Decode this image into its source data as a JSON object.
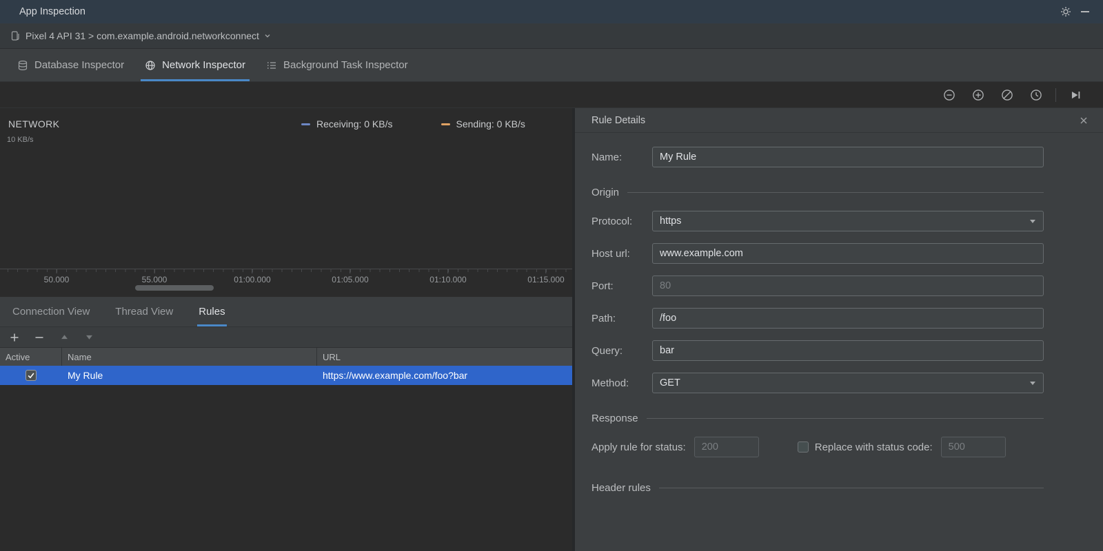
{
  "colors": {
    "accent_underline": "#4a88c7",
    "row_selection": "#2f65ca",
    "receiving_series": "#6d87c4",
    "sending_series": "#e0a263"
  },
  "title_bar": {
    "title": "App Inspection"
  },
  "device_bar": {
    "label": "Pixel 4 API 31 > com.example.android.networkconnect"
  },
  "inspector_tabs": [
    {
      "label": "Database Inspector",
      "selected": false
    },
    {
      "label": "Network Inspector",
      "selected": true
    },
    {
      "label": "Background Task Inspector",
      "selected": false
    }
  ],
  "chart": {
    "title": "NETWORK",
    "y_max_label": "10 KB/s",
    "legend": [
      {
        "label": "Receiving: 0 KB/s"
      },
      {
        "label": "Sending: 0 KB/s"
      }
    ],
    "x_ticks": [
      "50.000",
      "55.000",
      "01:00.000",
      "01:05.000",
      "01:10.000",
      "01:15.000"
    ]
  },
  "view_tabs": [
    {
      "label": "Connection View",
      "selected": false
    },
    {
      "label": "Thread View",
      "selected": false
    },
    {
      "label": "Rules",
      "selected": true
    }
  ],
  "rules_table": {
    "headers": {
      "active": "Active",
      "name": "Name",
      "url": "URL"
    },
    "rows": [
      {
        "active": true,
        "name": "My Rule",
        "url": "https://www.example.com/foo?bar"
      }
    ]
  },
  "rule_details": {
    "title": "Rule Details",
    "name_label": "Name:",
    "name_value": "My Rule",
    "origin_section": "Origin",
    "protocol_label": "Protocol:",
    "protocol_value": "https",
    "host_label": "Host url:",
    "host_value": "www.example.com",
    "port_label": "Port:",
    "port_placeholder": "80",
    "path_label": "Path:",
    "path_value": "/foo",
    "query_label": "Query:",
    "query_value": "bar",
    "method_label": "Method:",
    "method_value": "GET",
    "response_section": "Response",
    "status_label": "Apply rule for status:",
    "status_placeholder": "200",
    "replace_label": "Replace with status code:",
    "replace_placeholder": "500",
    "header_rules_section": "Header rules"
  },
  "icons": {
    "gear-icon": "settings gear",
    "minimize-icon": "minimize bar",
    "device-icon": "connected device",
    "chevron-down-icon": "dropdown chevron",
    "database-icon": "database cylinder",
    "globe-icon": "network globe",
    "task-list-icon": "bulleted list",
    "zoom-out-icon": "circled minus",
    "zoom-in-icon": "circled plus",
    "reset-zoom-icon": "circled slash",
    "zoom-to-selection-icon": "circled clock",
    "go-live-icon": "play to end",
    "add-icon": "plus",
    "remove-icon": "minus",
    "move-up-icon": "up triangle",
    "move-down-icon": "down triangle",
    "close-icon": "x",
    "checkmark-icon": "check"
  }
}
